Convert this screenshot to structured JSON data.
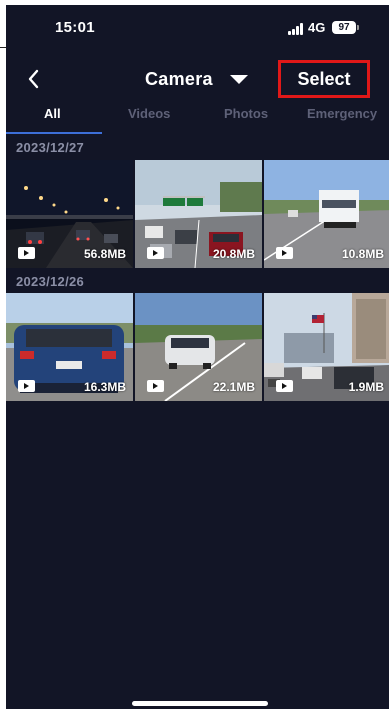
{
  "status_bar": {
    "time": "15:01",
    "network": "4G",
    "battery": "97"
  },
  "header": {
    "back_icon": "chevron-left-icon",
    "title": "Camera",
    "dropdown_icon": "caret-down-icon",
    "select_label": "Select",
    "select_highlight_color": "#e01818"
  },
  "tabs": [
    {
      "label": "All",
      "active": true
    },
    {
      "label": "Videos",
      "active": false
    },
    {
      "label": "Photos",
      "active": false
    },
    {
      "label": "Emergency",
      "active": false
    }
  ],
  "groups": [
    {
      "date": "2023/12/27",
      "items": [
        {
          "type": "video",
          "size": "56.8MB",
          "scene": "night highway"
        },
        {
          "type": "video",
          "size": "20.8MB",
          "scene": "highway traffic with green signs"
        },
        {
          "type": "video",
          "size": "10.8MB",
          "scene": "white truck on road"
        }
      ]
    },
    {
      "date": "2023/12/26",
      "items": [
        {
          "type": "video",
          "size": "16.3MB",
          "scene": "blue hatchback rear"
        },
        {
          "type": "video",
          "size": "22.1MB",
          "scene": "white suv on road"
        },
        {
          "type": "video",
          "size": "1.9MB",
          "scene": "city street with flag"
        }
      ]
    }
  ],
  "colors": {
    "background": "#121526",
    "tab_active": "#ffffff",
    "tab_inactive": "#5e6178",
    "tab_underline": "#3d6fd8",
    "date_text": "#8b8fa6"
  }
}
